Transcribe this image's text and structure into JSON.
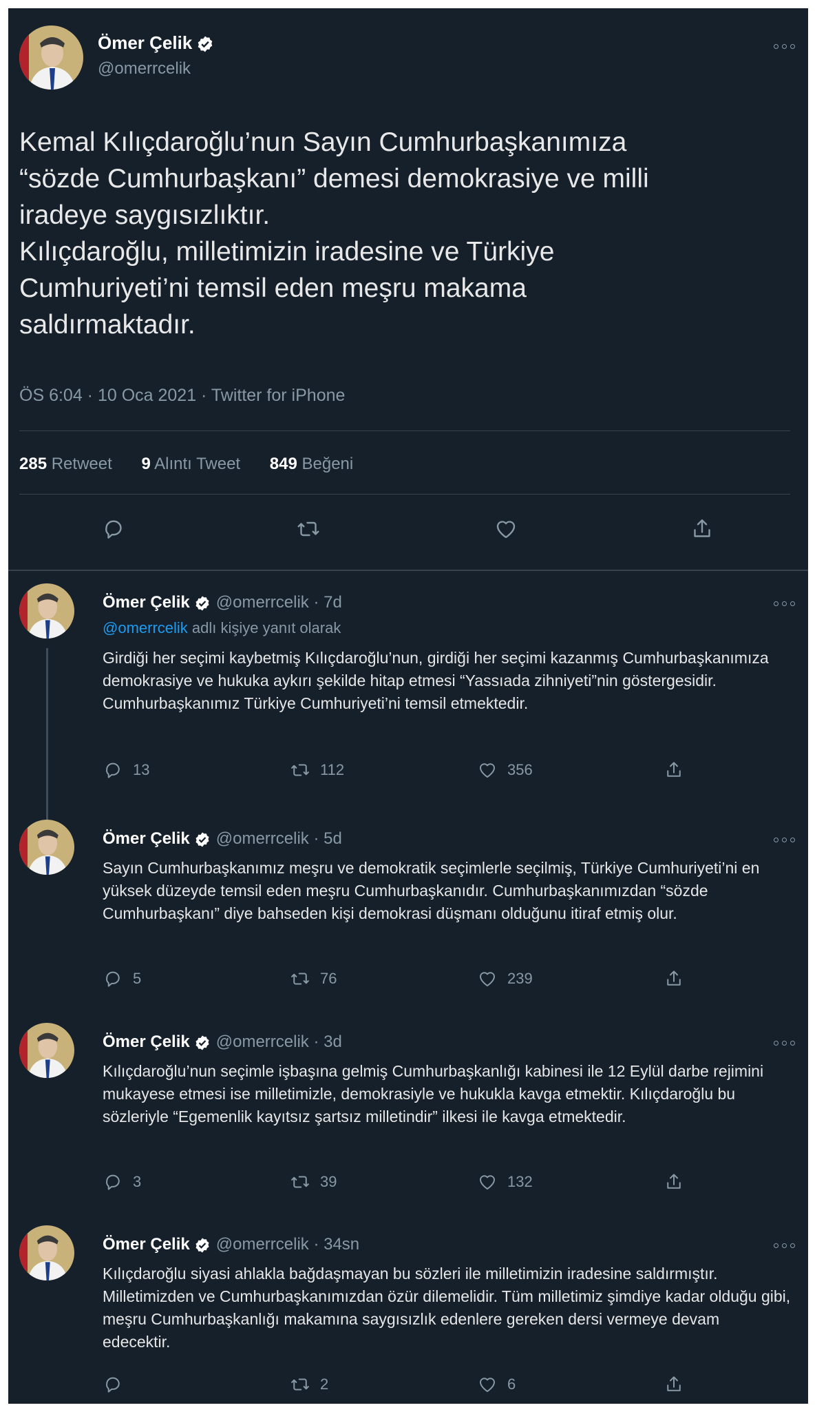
{
  "main_tweet": {
    "name": "Ömer Çelik",
    "handle": "@omerrcelik",
    "text": "Kemal Kılıçdaroğlu’nun Sayın Cumhurbaşkanımıza\n“sözde Cumhurbaşkanı” demesi demokrasiye ve milli\niradeye saygısızlıktır.\nKılıçdaroğlu, milletimizin iradesine ve Türkiye\nCumhuriyeti’ni temsil eden meşru makama\nsaldırmaktadır.",
    "timestamp": "ÖS 6:04 · 10 Oca 2021 · Twitter for iPhone",
    "retweets_count": "285",
    "retweets_label": "Retweet",
    "quotes_count": "9",
    "quotes_label": "Alıntı Tweet",
    "likes_count": "849",
    "likes_label": "Beğeni"
  },
  "replies": [
    {
      "name": "Ömer Çelik",
      "handle": "@omerrcelik",
      "time": "· 7d",
      "reply_to_handle": "@omerrcelik",
      "reply_to_suffix": " adlı kişiye yanıt olarak",
      "text": "Girdiği her seçimi kaybetmiş Kılıçdaroğlu’nun, girdiği her seçimi kazanmış Cumhurbaşkanımıza demokrasiye ve hukuka aykırı şekilde hitap etmesi “Yassıada zihniyeti”nin göstergesidir. Cumhurbaşkanımız Türkiye Cumhuriyeti’ni temsil etmektedir.",
      "replies": "13",
      "retweets": "112",
      "likes": "356"
    },
    {
      "name": "Ömer Çelik",
      "handle": "@omerrcelik",
      "time": "· 5d",
      "text": "Sayın Cumhurbaşkanımız meşru ve demokratik seçimlerle seçilmiş, Türkiye Cumhuriyeti’ni en yüksek düzeyde temsil eden meşru Cumhurbaşkanıdır. Cumhurbaşkanımızdan “sözde Cumhurbaşkanı” diye bahseden kişi demokrasi düşmanı olduğunu itiraf etmiş olur.",
      "replies": "5",
      "retweets": "76",
      "likes": "239"
    },
    {
      "name": "Ömer Çelik",
      "handle": "@omerrcelik",
      "time": "· 3d",
      "text": "Kılıçdaroğlu’nun seçimle işbaşına gelmiş Cumhurbaşkanlığı kabinesi ile 12 Eylül darbe rejimini mukayese etmesi ise milletimizle, demokrasiyle ve hukukla kavga etmektir. Kılıçdaroğlu bu sözleriyle “Egemenlik kayıtsız şartsız milletindir” ilkesi ile kavga etmektedir.",
      "replies": "3",
      "retweets": "39",
      "likes": "132"
    },
    {
      "name": "Ömer Çelik",
      "handle": "@omerrcelik",
      "time": "· 34sn",
      "text": "Kılıçdaroğlu siyasi ahlakla bağdaşmayan bu sözleri ile milletimizin iradesine saldırmıştır. Milletimizden ve Cumhurbaşkanımızdan özür dilemelidir. Tüm milletimiz şimdiye kadar olduğu gibi, meşru Cumhurbaşkanlığı makamına saygısızlık edenlere gereken dersi vermeye devam edecektir.",
      "replies": "",
      "retweets": "2",
      "likes": "6"
    }
  ],
  "colors": {
    "background": "#15202b",
    "text": "#e6e6e6",
    "secondary": "#8899a6",
    "link": "#1d9bf0",
    "verified": "#ffffff"
  },
  "icons": [
    "more-icon",
    "verified-icon",
    "reply-icon",
    "retweet-icon",
    "like-icon",
    "share-icon"
  ]
}
